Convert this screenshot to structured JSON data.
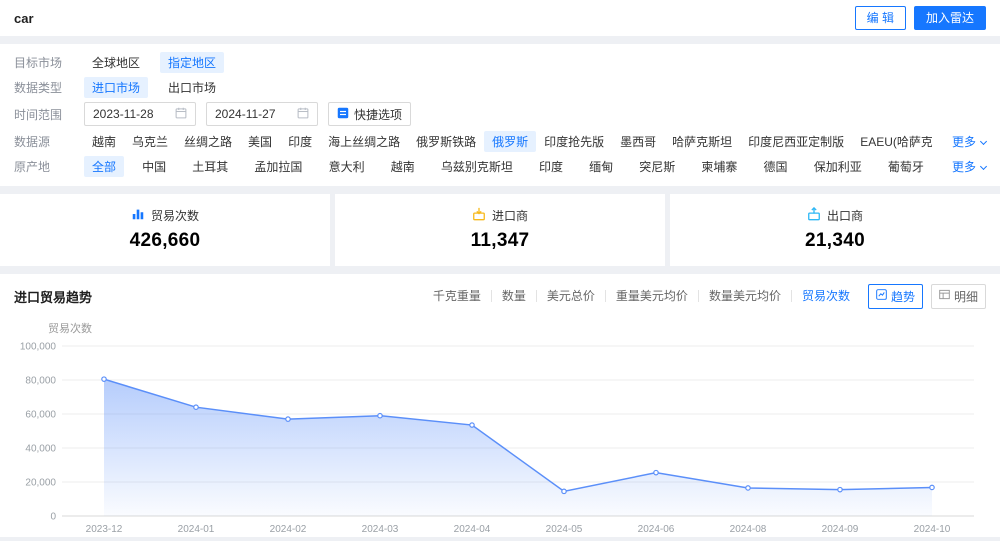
{
  "header": {
    "title": "car",
    "edit_button": "编 辑",
    "add_radar_button": "加入雷达"
  },
  "filters": {
    "target_market": {
      "label": "目标市场",
      "options": [
        {
          "label": "全球地区",
          "active": false
        },
        {
          "label": "指定地区",
          "active": true
        }
      ]
    },
    "data_type": {
      "label": "数据类型",
      "options": [
        {
          "label": "进口市场",
          "active": true
        },
        {
          "label": "出口市场",
          "active": false
        }
      ]
    },
    "time_range": {
      "label": "时间范围",
      "start": "2023-11-28",
      "end": "2024-11-27",
      "quick_button": "快捷选项"
    },
    "data_source": {
      "label": "数据源",
      "more": "更多",
      "options": [
        {
          "label": "越南",
          "active": false
        },
        {
          "label": "乌克兰",
          "active": false
        },
        {
          "label": "丝绸之路",
          "active": false
        },
        {
          "label": "美国",
          "active": false
        },
        {
          "label": "印度",
          "active": false
        },
        {
          "label": "海上丝绸之路",
          "active": false
        },
        {
          "label": "俄罗斯铁路",
          "active": false
        },
        {
          "label": "俄罗斯",
          "active": true
        },
        {
          "label": "印度抢先版",
          "active": false
        },
        {
          "label": "墨西哥",
          "active": false
        },
        {
          "label": "哈萨克斯坦",
          "active": false
        },
        {
          "label": "印度尼西亚定制版",
          "active": false
        },
        {
          "label": "EAEU(哈萨克斯坦)",
          "active": false
        }
      ]
    },
    "origin": {
      "label": "原产地",
      "more": "更多",
      "options": [
        {
          "label": "全部",
          "active": true
        },
        {
          "label": "中国",
          "active": false
        },
        {
          "label": "土耳其",
          "active": false
        },
        {
          "label": "孟加拉国",
          "active": false
        },
        {
          "label": "意大利",
          "active": false
        },
        {
          "label": "越南",
          "active": false
        },
        {
          "label": "乌兹别克斯坦",
          "active": false
        },
        {
          "label": "印度",
          "active": false
        },
        {
          "label": "缅甸",
          "active": false
        },
        {
          "label": "突尼斯",
          "active": false
        },
        {
          "label": "柬埔寨",
          "active": false
        },
        {
          "label": "德国",
          "active": false
        },
        {
          "label": "保加利亚",
          "active": false
        },
        {
          "label": "葡萄牙",
          "active": false
        }
      ]
    }
  },
  "stats": [
    {
      "label": "贸易次数",
      "value": "426,660",
      "icon": "bar-chart-icon",
      "color": "#1677ff"
    },
    {
      "label": "进口商",
      "value": "11,347",
      "icon": "importer-icon",
      "color": "#f7ba1e"
    },
    {
      "label": "出口商",
      "value": "21,340",
      "icon": "exporter-icon",
      "color": "#2db7f5"
    }
  ],
  "chart_section": {
    "title": "进口贸易趋势",
    "metrics": [
      {
        "label": "千克重量",
        "active": false
      },
      {
        "label": "数量",
        "active": false
      },
      {
        "label": "美元总价",
        "active": false
      },
      {
        "label": "重量美元均价",
        "active": false
      },
      {
        "label": "数量美元均价",
        "active": false
      },
      {
        "label": "贸易次数",
        "active": true
      }
    ],
    "view_buttons": [
      {
        "label": "趋势",
        "active": true
      },
      {
        "label": "明细",
        "active": false
      }
    ]
  },
  "chart_data": {
    "type": "area",
    "title": "进口贸易趋势",
    "ylabel": "贸易次数",
    "x": [
      "2023-12",
      "2024-01",
      "2024-02",
      "2024-03",
      "2024-04",
      "2024-05",
      "2024-06",
      "2024-08",
      "2024-09",
      "2024-10"
    ],
    "values": [
      80500,
      64000,
      57000,
      59000,
      53500,
      14500,
      25500,
      16500,
      15500,
      16800
    ],
    "ylim": [
      0,
      100000
    ],
    "yticks": [
      0,
      20000,
      40000,
      60000,
      80000,
      100000
    ],
    "grid": true,
    "legend": false,
    "line_color": "#5b8ff9",
    "area_color_top": "rgba(91,143,249,0.45)",
    "area_color_bottom": "rgba(91,143,249,0.03)"
  }
}
